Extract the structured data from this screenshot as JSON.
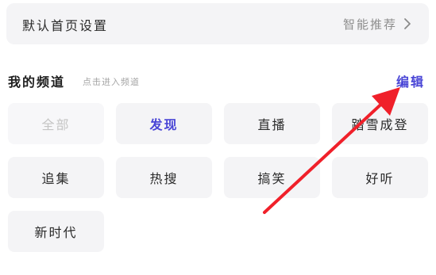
{
  "homepage_setting": {
    "label": "默认首页设置",
    "value": "智能推荐",
    "chevron_icon": "chevron-right-icon"
  },
  "channels": {
    "title": "我的频道",
    "hint": "点击进入频道",
    "edit_label": "编辑",
    "edit_color": "#4a46d6",
    "items": [
      {
        "label": "全部",
        "state": "disabled"
      },
      {
        "label": "发现",
        "state": "active"
      },
      {
        "label": "直播",
        "state": "normal"
      },
      {
        "label": "踏雪成登",
        "state": "normal"
      },
      {
        "label": "追集",
        "state": "normal"
      },
      {
        "label": "热搜",
        "state": "normal"
      },
      {
        "label": "搞笑",
        "state": "normal"
      },
      {
        "label": "好听",
        "state": "normal"
      },
      {
        "label": "新时代",
        "state": "normal"
      }
    ]
  },
  "annotation": {
    "arrow_icon": "red-arrow-icon",
    "color": "#f0202a"
  }
}
